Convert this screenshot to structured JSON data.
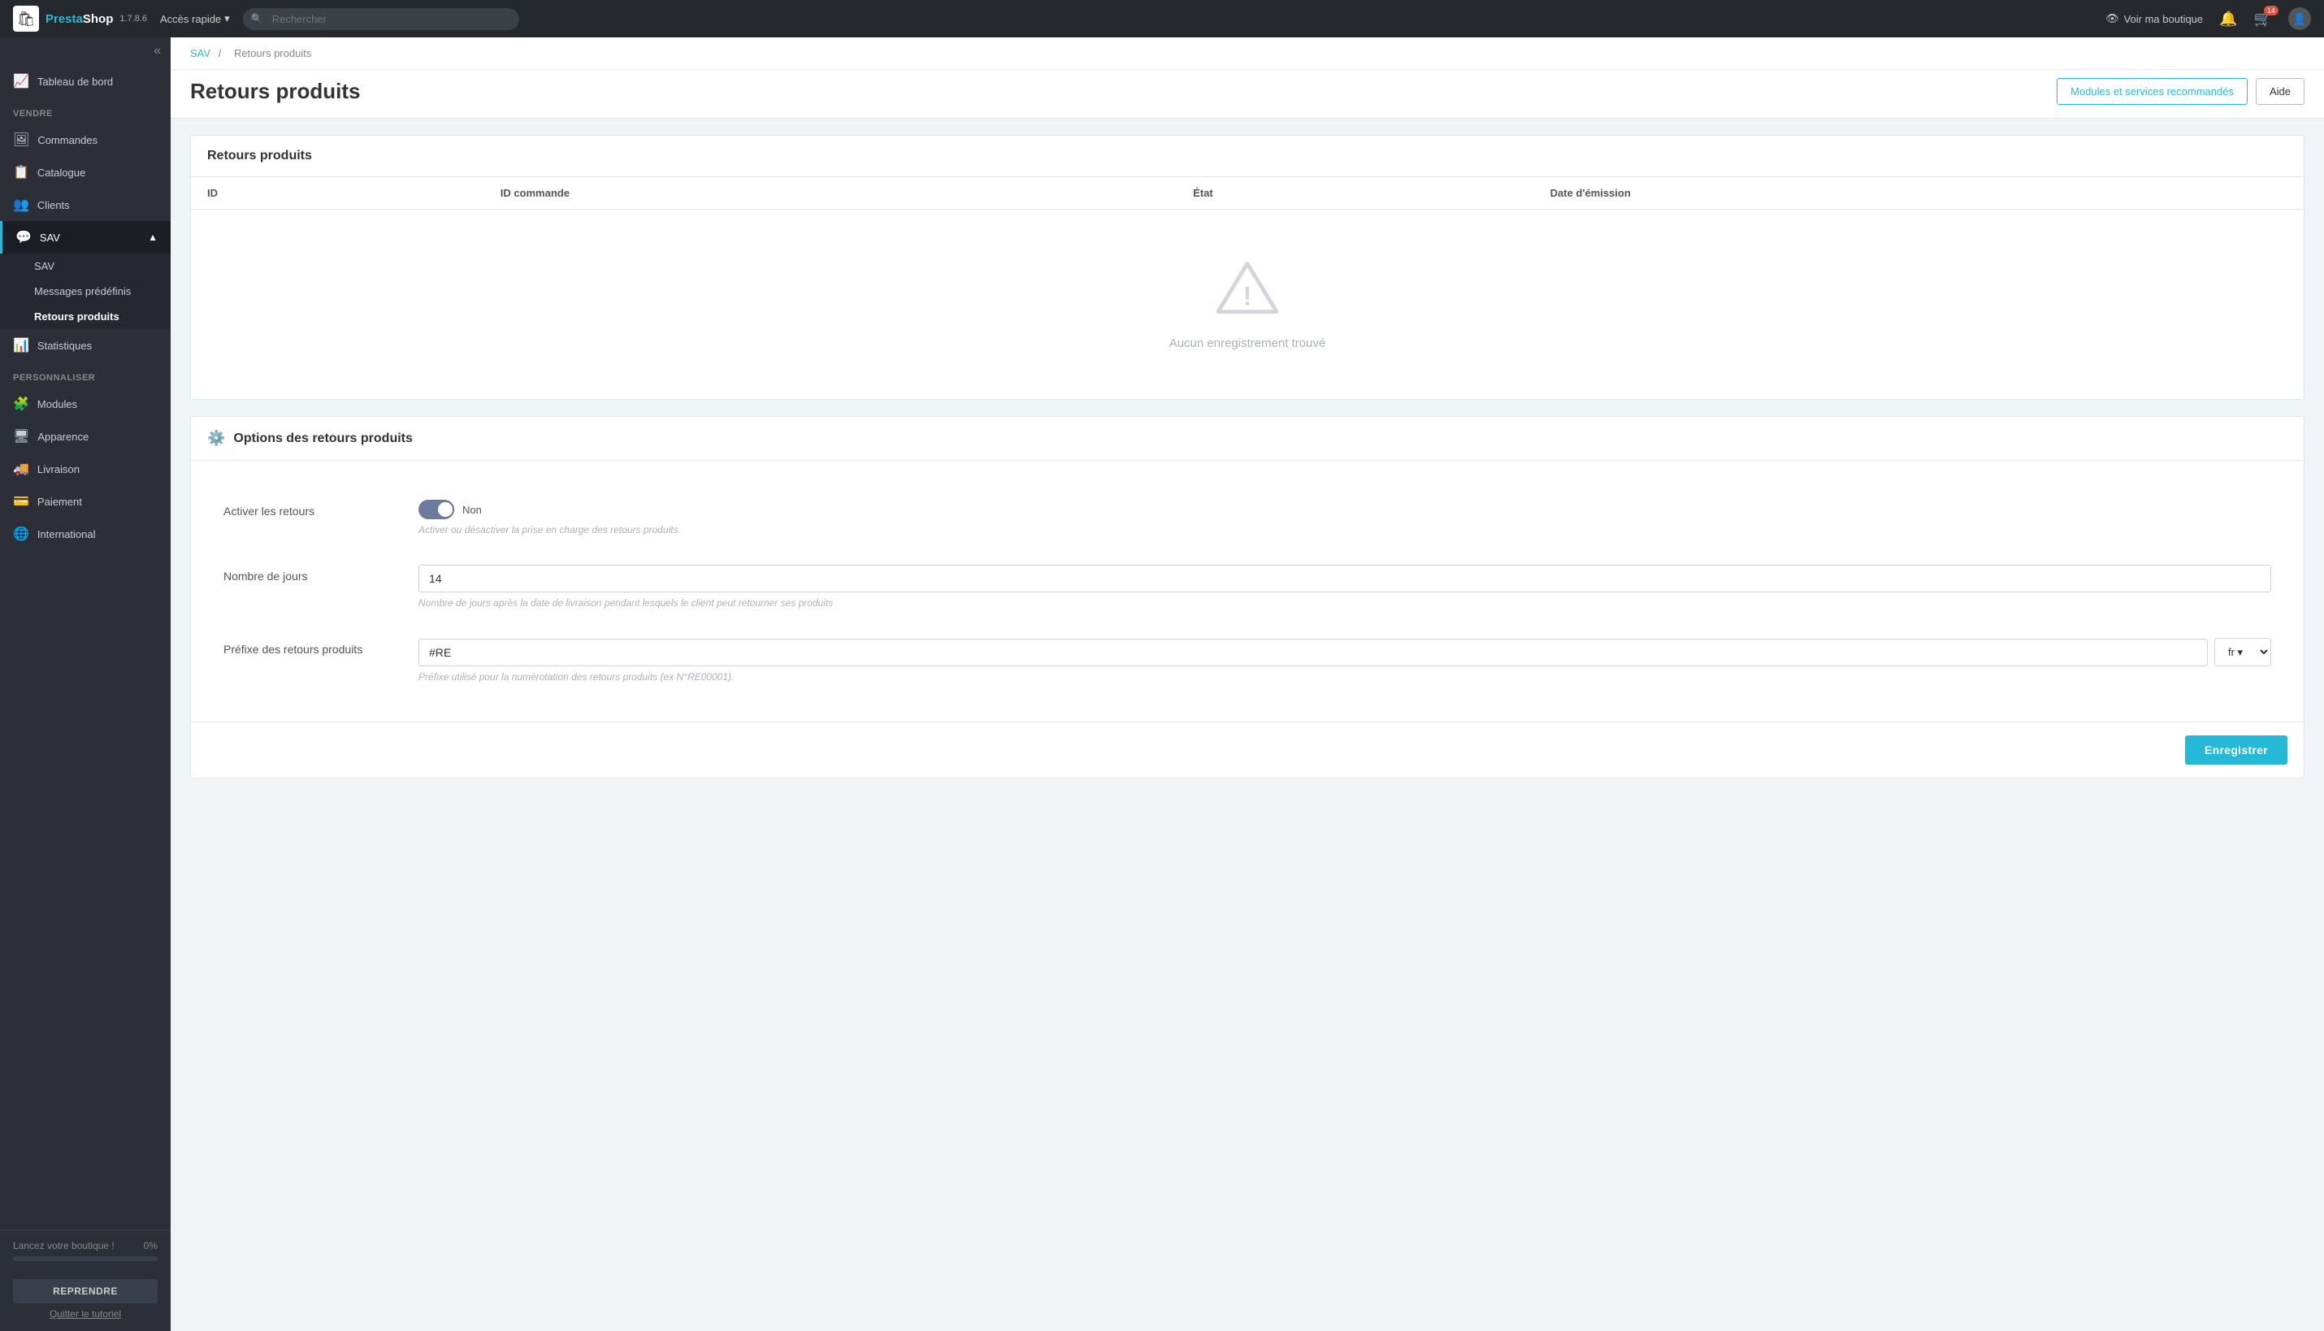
{
  "app": {
    "name_pre": "Presta",
    "name_shop": "Shop",
    "version": "1.7.8.6"
  },
  "topbar": {
    "quick_access": "Accès rapide",
    "search_placeholder": "Rechercher",
    "view_shop": "Voir ma boutique",
    "notification_count": "14"
  },
  "sidebar": {
    "collapse_icon": "«",
    "dashboard_label": "Tableau de bord",
    "section_vendre": "VENDRE",
    "item_commandes": "Commandes",
    "item_catalogue": "Catalogue",
    "item_clients": "Clients",
    "item_sav": "SAV",
    "submenu_sav": "SAV",
    "submenu_messages": "Messages prédéfinis",
    "submenu_retours": "Retours produits",
    "item_statistiques": "Statistiques",
    "section_personnaliser": "PERSONNALISER",
    "item_modules": "Modules",
    "item_apparence": "Apparence",
    "item_livraison": "Livraison",
    "item_paiement": "Paiement",
    "item_international": "International",
    "progress_label": "Lancez votre boutique !",
    "progress_value": "0%",
    "btn_reprendre": "REPRENDRE",
    "btn_quitter": "Quitter le tutoriel"
  },
  "breadcrumb": {
    "parent": "SAV",
    "current": "Retours produits"
  },
  "page": {
    "title": "Retours produits",
    "btn_modules": "Modules et services recommandés",
    "btn_aide": "Aide"
  },
  "table": {
    "title": "Retours produits",
    "col_id": "ID",
    "col_id_commande": "ID commande",
    "col_etat": "État",
    "col_date": "Date d'émission",
    "empty_text": "Aucun enregistrement trouvé"
  },
  "options": {
    "title": "Options des retours produits",
    "activer_label": "Activer les retours",
    "activer_value": "Non",
    "activer_desc": "Activer ou désactiver la prise en charge des retours produits",
    "jours_label": "Nombre de jours",
    "jours_value": "14",
    "jours_desc": "Nombre de jours après la date de livraison pendant lesquels le client peut retourner ses produits",
    "prefixe_label": "Préfixe des retours produits",
    "prefixe_value": "#RE",
    "prefixe_desc": "Préfixe utilisé pour la numérotation des retours produits (ex N°RE00001).",
    "lang_value": "fr",
    "btn_save": "Enregistrer"
  }
}
